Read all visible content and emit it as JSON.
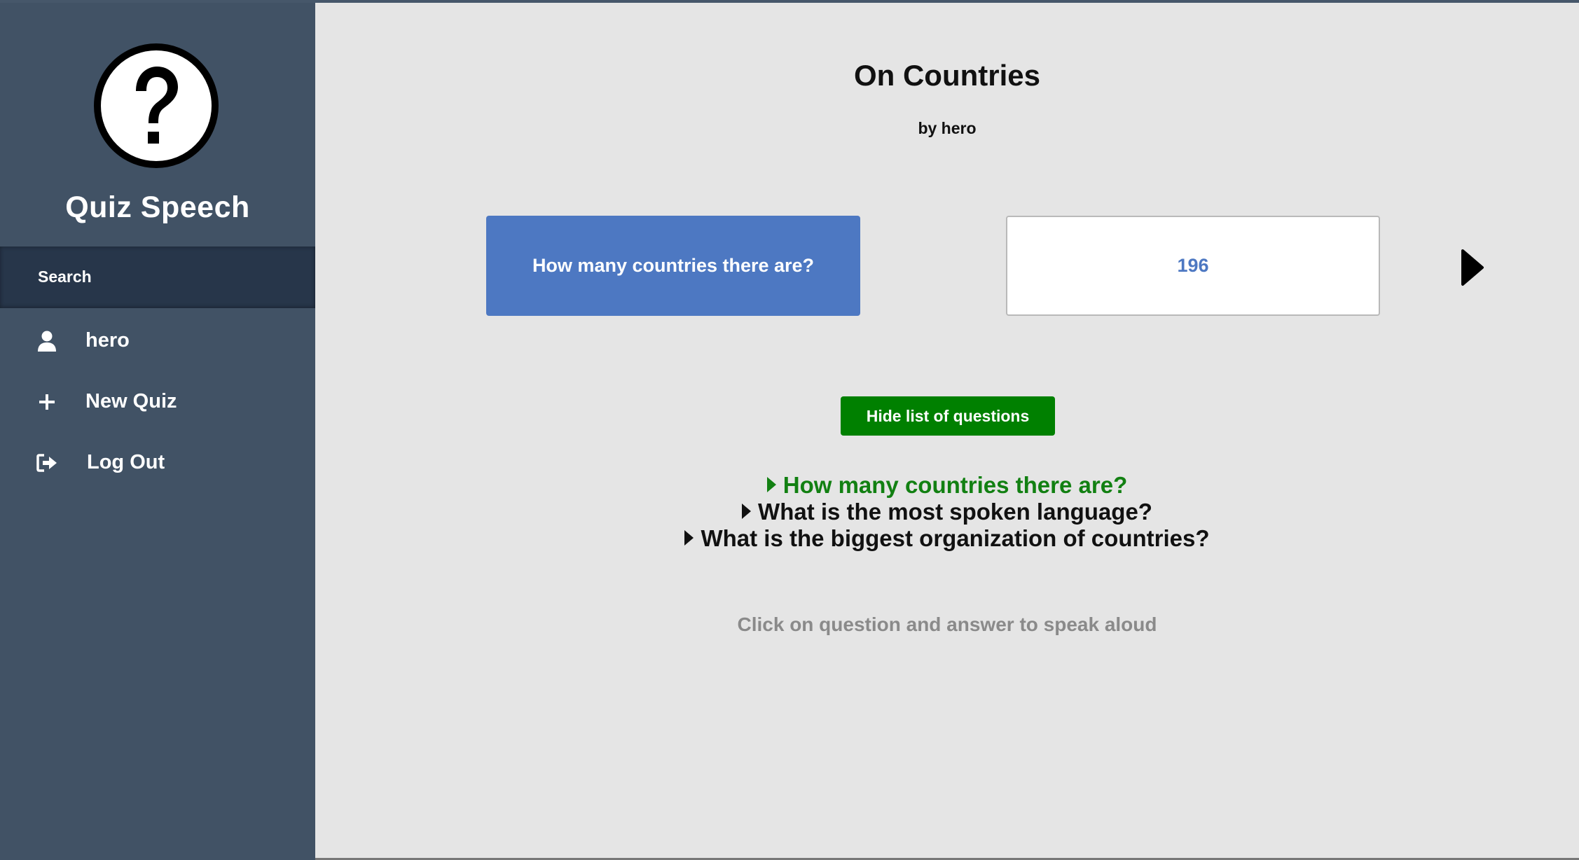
{
  "sidebar": {
    "brand": "Quiz Speech",
    "logo_icon": "question-mark-circle-icon",
    "search_label": "Search",
    "items": [
      {
        "label": "hero",
        "icon": "user-icon"
      },
      {
        "label": "New Quiz",
        "icon": "plus-icon"
      },
      {
        "label": "Log Out",
        "icon": "logout-icon"
      }
    ]
  },
  "quiz": {
    "title": "On Countries",
    "author": "by hero",
    "current_question": "How many countries there are?",
    "current_answer": "196",
    "next_icon": "play-arrow-icon",
    "toggle_label": "Hide list of questions",
    "questions": [
      "How many countries there are?",
      "What is the most spoken language?",
      "What is the biggest organization of countries?"
    ],
    "hint": "Click on question and answer to speak aloud"
  },
  "colors": {
    "sidebar_bg": "#415265",
    "search_bg": "#27364a",
    "question_card": "#4d78c2",
    "button_green": "#008000",
    "active_question": "#128012",
    "hint_gray": "#8a8a8a"
  }
}
